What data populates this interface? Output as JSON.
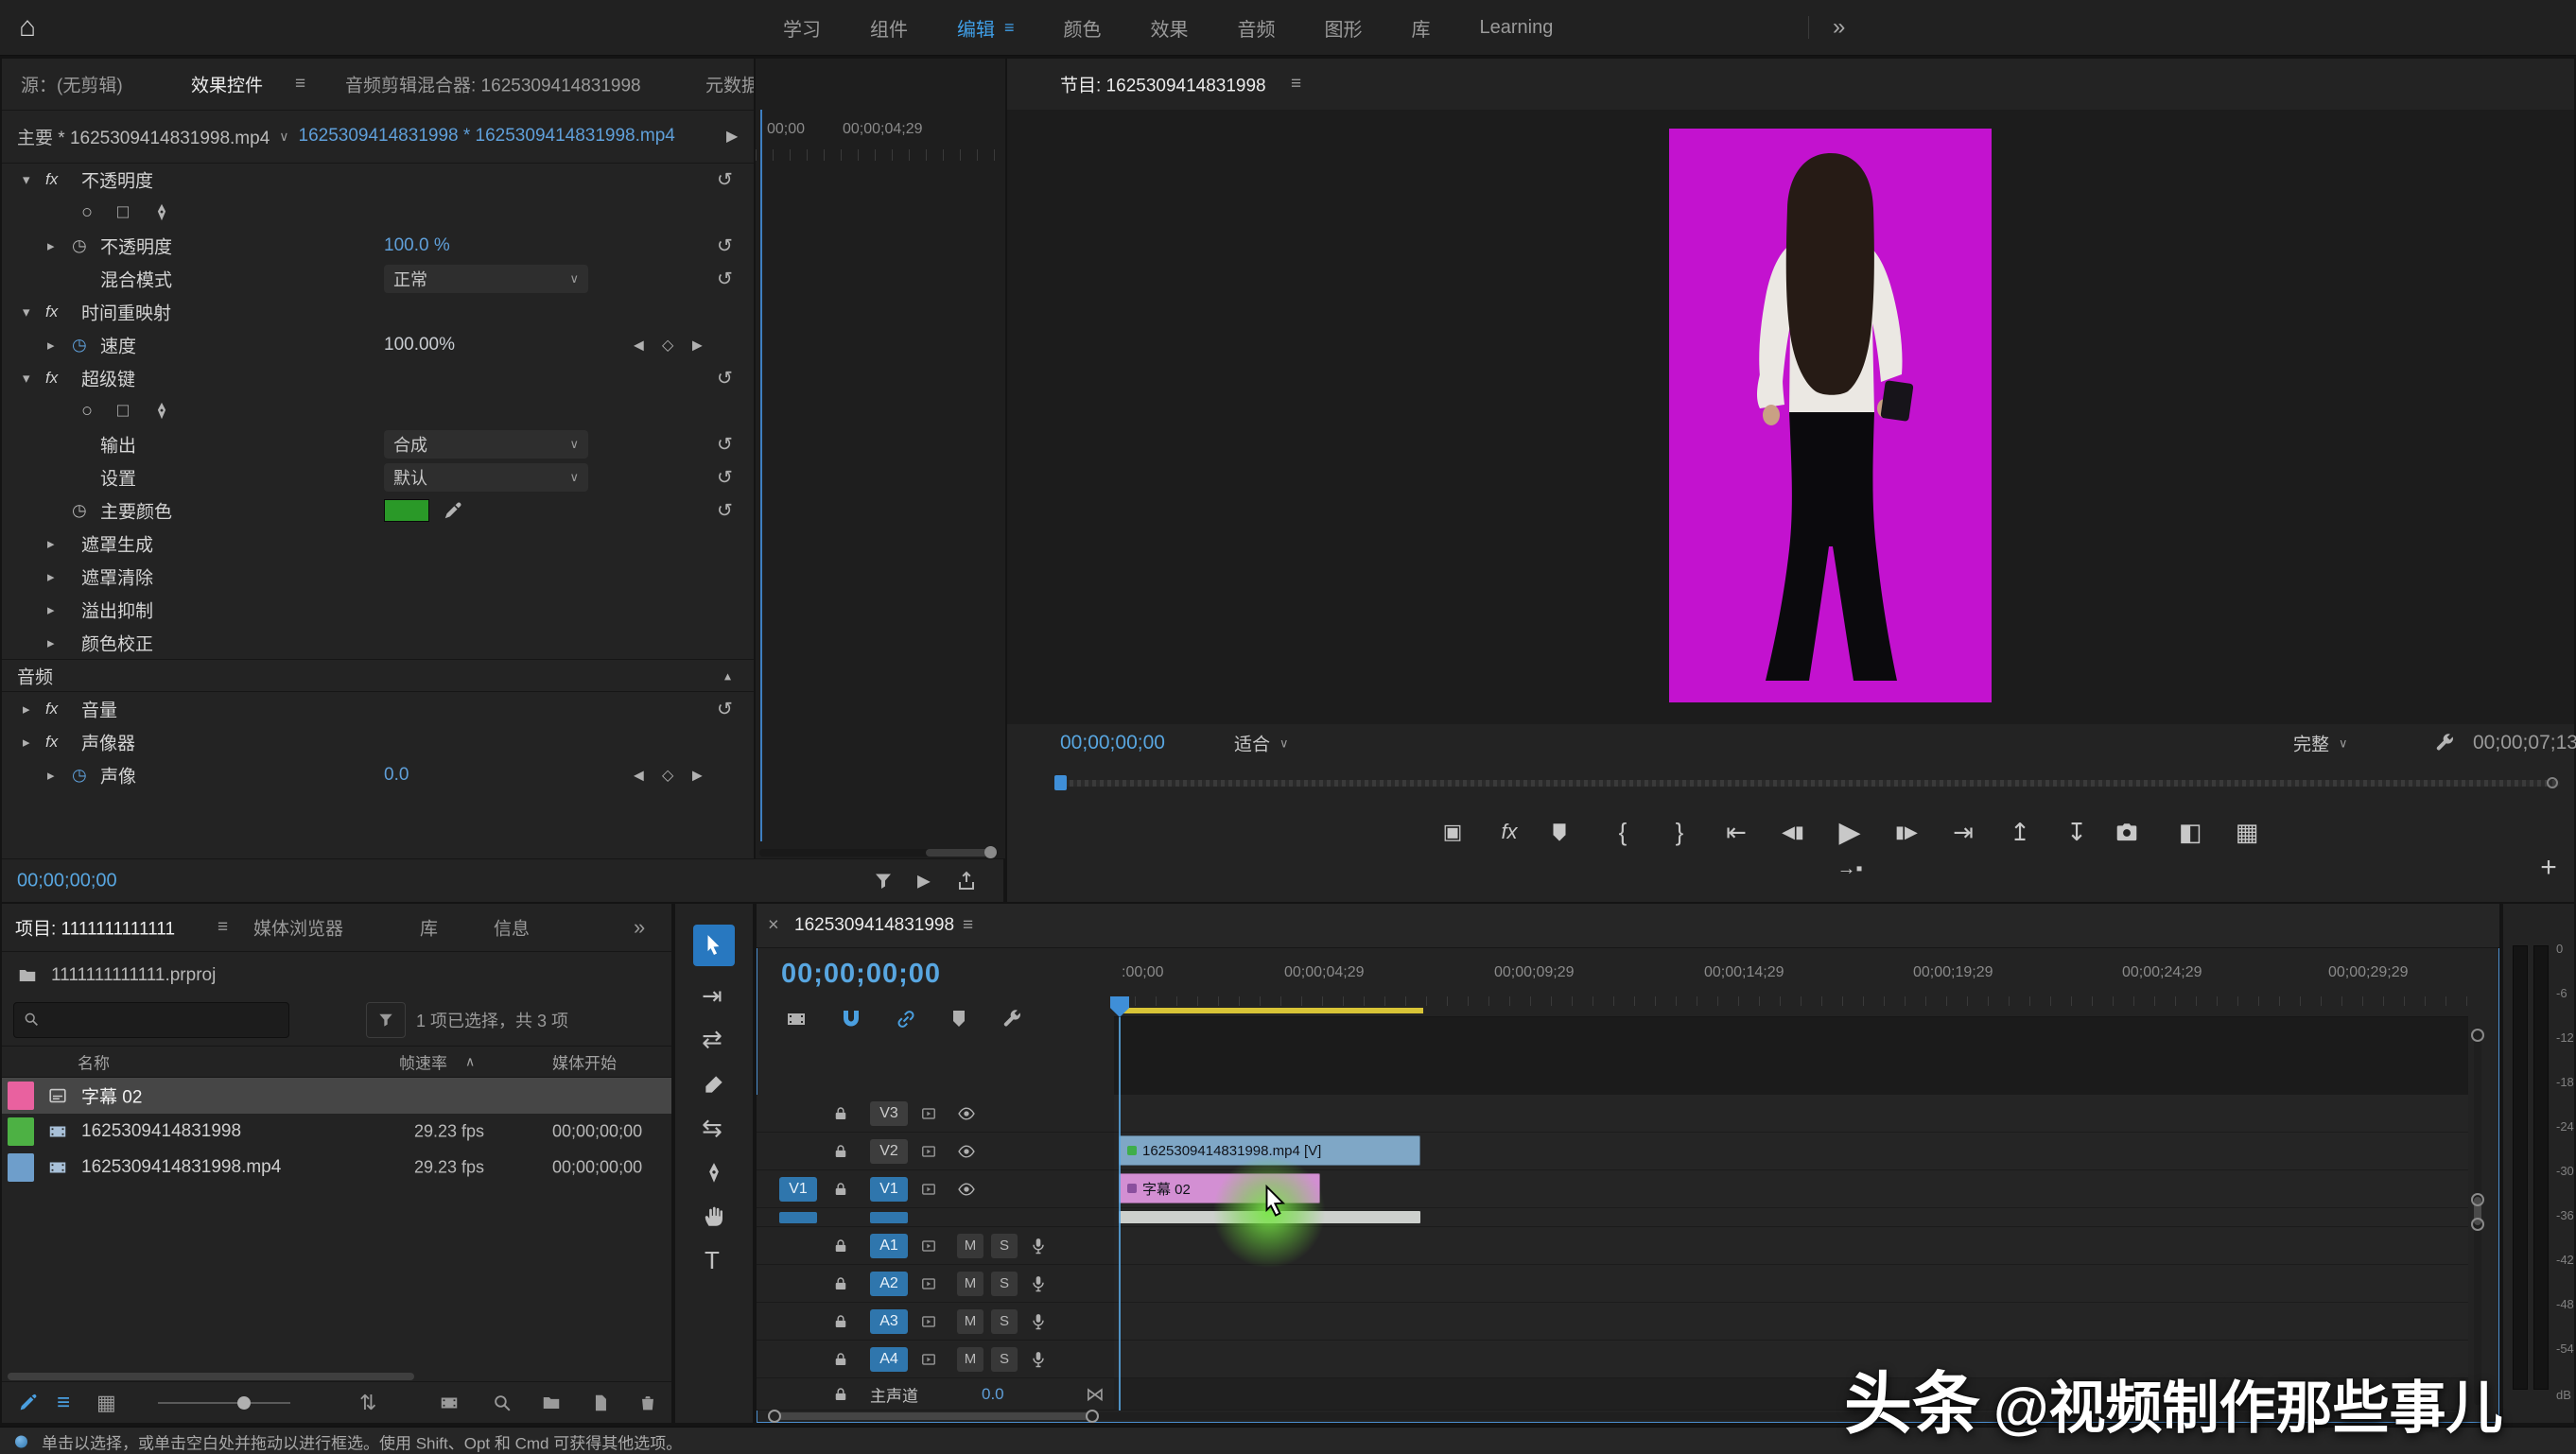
{
  "topbar": {
    "items": [
      "学习",
      "组件",
      "编辑",
      "颜色",
      "效果",
      "音频",
      "图形",
      "库",
      "Learning"
    ],
    "active_item": "编辑"
  },
  "icons": {
    "home": "⌂",
    "menu": "≡",
    "overflow": "»",
    "chevron_down": "∨",
    "twirl_open": "▾",
    "twirl_closed": "▸",
    "sort_asc": "∧",
    "reset": "↺",
    "fx": "fx",
    "ellipse": "○",
    "rectangle": "□",
    "stopwatch": "◷",
    "prev_keyframe": "◀",
    "add_keyframe": "◇",
    "next_keyframe": "▶",
    "collapse": "▴",
    "play": "▶",
    "step_back": "◀▮",
    "step_forward": "▮▶",
    "go_to_in": "⇤",
    "go_to_out": "⇥",
    "lift": "↥",
    "extract": "↧",
    "mark_in": "{",
    "mark_out": "}",
    "safe_margins": "▣",
    "compare": "◧",
    "multicam": "▦",
    "overwrite": "→▪",
    "add": "+",
    "close": "×",
    "fit": "⋈",
    "list_view": "≡",
    "icon_view": "▦",
    "sort": "⇅",
    "track_select": "⇥",
    "ripple_edit": "⇄",
    "slip": "⇆",
    "type_tool": "T",
    "play_clip": "▶"
  },
  "effect_controls": {
    "tabs": {
      "source": "源：(无剪辑)",
      "effects": "效果控件",
      "audio_mixer": "音频剪辑混合器: 1625309414831998",
      "metadata": "元数据"
    },
    "header": {
      "master_clip": "主要 * 1625309414831998.mp4",
      "sequence_clip": "1625309414831998 * 1625309414831998.mp4"
    },
    "ruler": {
      "t0": "00;00",
      "t1": "00;00;04;29"
    },
    "groups": {
      "opacity": "不透明度",
      "opacity_param": "不透明度",
      "opacity_value": "100.0 %",
      "blend_mode_label": "混合模式",
      "blend_mode_value": "正常",
      "time_remap": "时间重映射",
      "speed_label": "速度",
      "speed_value": "100.00%",
      "ultra_key": "超级键",
      "output_label": "输出",
      "output_value": "合成",
      "setting_label": "设置",
      "setting_value": "默认",
      "key_color_label": "主要颜色",
      "matte_generation": "遮罩生成",
      "matte_cleanup": "遮罩清除",
      "spill_suppression": "溢出抑制",
      "color_correction": "颜色校正",
      "audio_section": "音频",
      "volume": "音量",
      "panner": "声像器",
      "pan_label": "声像",
      "pan_value": "0.0"
    },
    "footer_timecode": "00;00;00;00"
  },
  "program": {
    "tab": "节目: 1625309414831998",
    "timecode": "00;00;00;00",
    "zoom_level": "适合",
    "resolution": "完整",
    "duration": "00;00;07;13"
  },
  "project": {
    "tab": "项目: 1111111111111",
    "tabs": {
      "media_browser": "媒体浏览器",
      "libraries": "库",
      "info": "信息"
    },
    "bin_name": "1111111111111.prproj",
    "selection_status": "1 项已选择，共 3 项",
    "columns": {
      "name": "名称",
      "frame_rate": "帧速率",
      "media_start": "媒体开始"
    },
    "items": [
      {
        "name": "字幕 02",
        "frame_rate": "",
        "media_start": "",
        "label_color": "#e9619f"
      },
      {
        "name": "1625309414831998",
        "frame_rate": "29.23 fps",
        "media_start": "00;00;00;00",
        "label_color": "#4db144"
      },
      {
        "name": "1625309414831998.mp4",
        "frame_rate": "29.23 fps",
        "media_start": "00;00;00;00",
        "label_color": "#6e9ecb"
      }
    ]
  },
  "timeline": {
    "tab": "1625309414831998",
    "timecode": "00;00;00;00",
    "ruler_labels": [
      ":00;00",
      "00;00;04;29",
      "00;00;09;29",
      "00;00;14;29",
      "00;00;19;29",
      "00;00;24;29",
      "00;00;29;29"
    ],
    "video_tracks": [
      {
        "name": "V3"
      },
      {
        "name": "V2",
        "clip": "1625309414831998.mp4 [V]"
      },
      {
        "name": "V1",
        "clip": "字幕 02",
        "source_patch": "V1"
      }
    ],
    "audio_tracks": [
      "A1",
      "A2",
      "A3",
      "A4"
    ],
    "mute_label": "M",
    "solo_label": "S",
    "master": {
      "name": "主声道",
      "value": "0.0"
    }
  },
  "meters": {
    "ticks": [
      "0",
      "-6",
      "-12",
      "-18",
      "-24",
      "-30",
      "-36",
      "-42",
      "-48",
      "-54"
    ],
    "unit": "dB"
  },
  "status_bar": {
    "message": "单击以选择，或单击空白处并拖动以进行框选。使用 Shift、Opt 和 Cmd 可获得其他选项。"
  },
  "watermark": {
    "prefix": "头条",
    "handle": "@视频制作那些事儿"
  },
  "colors": {
    "accent_blue": "#3f8fd8",
    "timecode_blue": "#58a6e0",
    "value_blue": "#5f9fd9",
    "canvas_magenta": "#c312cf",
    "key_color_green": "#2a9928",
    "video_clip": "#7fa7c6",
    "title_clip": "#d38fd3",
    "render_bar_yellow": "#d8c437",
    "label_pink": "#e9619f",
    "label_green": "#4db144",
    "label_blue": "#6e9ecb"
  }
}
